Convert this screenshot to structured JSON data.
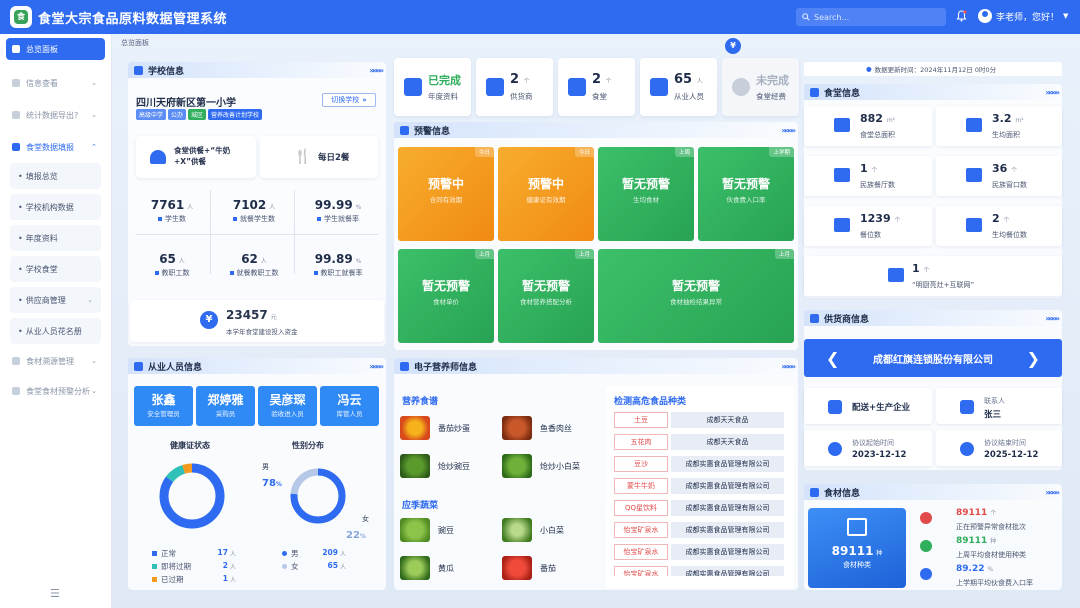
{
  "app": {
    "title": "食堂大宗食品原料数据管理系统",
    "logo_icon": "canteen-logo",
    "accent": "#2f6bf0"
  },
  "topbar": {
    "search_placeholder": "Search...",
    "user": "李老师，您好！"
  },
  "breadcrumb": "总览面板",
  "sidebar": {
    "items": [
      {
        "label": "总览面板",
        "active": true
      },
      {
        "label": "信息查看"
      },
      {
        "label": "统计数据导出?"
      },
      {
        "label": "食堂数据填报"
      }
    ],
    "subitems": [
      "填报总览",
      "学校机构数据",
      "年度资料",
      "学校食堂",
      "供应商管理",
      "从业人员花名册"
    ],
    "items_after": [
      "食材溯源管理",
      "食堂食材预警分析"
    ]
  },
  "school": {
    "header": "学校信息",
    "name": "四川天府新区第一小学",
    "switch_label": "切换学校",
    "tags": [
      "高级中学",
      "公办",
      "城区",
      "营养改善计划学校"
    ],
    "meal_supply": "食堂供餐+“牛奶+X”供餐",
    "meals_per_day": "每日2餐",
    "stats": [
      {
        "num": "7761",
        "unit": "人",
        "label": "学生数"
      },
      {
        "num": "7102",
        "unit": "人",
        "label": "就餐学生数"
      },
      {
        "num": "99.99",
        "unit": "%",
        "label": "学生就餐率"
      },
      {
        "num": "65",
        "unit": "人",
        "label": "教职工数"
      },
      {
        "num": "62",
        "unit": "人",
        "label": "就餐教职工数"
      },
      {
        "num": "99.89",
        "unit": "%",
        "label": "教职工就餐率"
      }
    ],
    "investment": {
      "num": "23457",
      "unit": "元",
      "label": "本学年食堂建设投入资金"
    }
  },
  "update_time": "数据更新时间：2024年11月12日 0时0分",
  "kpis": [
    {
      "num": "已完成",
      "unit": "",
      "label": "年度资料"
    },
    {
      "num": "2",
      "unit": "个",
      "label": "供货商"
    },
    {
      "num": "2",
      "unit": "个",
      "label": "食堂"
    },
    {
      "num": "65",
      "unit": "人",
      "label": "从业人员"
    },
    {
      "num": "未完成",
      "unit": "",
      "label": "食堂经费"
    }
  ],
  "warning": {
    "header": "预警信息",
    "cards": [
      {
        "title": "预警中",
        "sub": "合同有效期",
        "badge": "今日",
        "color": "#f39a1f"
      },
      {
        "title": "预警中",
        "sub": "健康证有效期",
        "badge": "今日",
        "color": "#f39a1f"
      },
      {
        "title": "暂无预警",
        "sub": "生均食材",
        "badge": "上周",
        "color": "#2fae5c"
      },
      {
        "title": "暂无预警",
        "sub": "伙食费入口率",
        "badge": "上学期",
        "color": "#2fae5c"
      },
      {
        "title": "暂无预警",
        "sub": "食材单价",
        "badge": "上月",
        "color": "#2fae5c"
      },
      {
        "title": "暂无预警",
        "sub": "食材营养搭配分析",
        "badge": "上月",
        "color": "#2fae5c"
      },
      {
        "title": "暂无预警",
        "sub": "食材抽检结果异常",
        "badge": "上月",
        "color": "#2fae5c"
      }
    ]
  },
  "canteen": {
    "header": "食堂信息",
    "cards": [
      {
        "num": "882",
        "unit": "m²",
        "label": "食堂总面积"
      },
      {
        "num": "3.2",
        "unit": "m²",
        "label": "生均面积"
      },
      {
        "num": "1",
        "unit": "个",
        "label": "民族餐厅数"
      },
      {
        "num": "36",
        "unit": "个",
        "label": "民族窗口数"
      },
      {
        "num": "1239",
        "unit": "个",
        "label": "餐位数"
      },
      {
        "num": "2",
        "unit": "个",
        "label": "生均餐位数"
      },
      {
        "num": "1",
        "unit": "个",
        "label": "“明厨亮灶+互联网”"
      }
    ]
  },
  "supplier": {
    "header": "供货商信息",
    "name": "成都红旗连锁股份有限公司",
    "type": "配送+生产企业",
    "contact_label": "联系人",
    "contact": "张三",
    "start_label": "协议起始时间",
    "start": "2023-12-12",
    "end_label": "协议结束时间",
    "end": "2025-12-12"
  },
  "staff": {
    "header": "从业人员信息",
    "people": [
      {
        "name": "张鑫",
        "role": "安全管理员"
      },
      {
        "name": "郑婷雅",
        "role": "采购员"
      },
      {
        "name": "吴彦琛",
        "role": "验收进入员"
      },
      {
        "name": "冯云",
        "role": "库管人员"
      }
    ],
    "health_title": "健康证状态",
    "health": [
      {
        "label": "正常",
        "value": 17,
        "unit": "人",
        "color": "#2f6bf0"
      },
      {
        "label": "即将过期",
        "value": 2,
        "unit": "人",
        "color": "#2fc0b8"
      },
      {
        "label": "已过期",
        "value": 1,
        "unit": "人",
        "color": "#f39a1f"
      }
    ],
    "gender_title": "性别分布",
    "gender": [
      {
        "label": "男",
        "pct": "78",
        "value": 209,
        "unit": "人",
        "color": "#2f6bf0"
      },
      {
        "label": "女",
        "pct": "22",
        "value": 65,
        "unit": "人",
        "color": "#b6c8e8"
      }
    ],
    "pct_unit": "%"
  },
  "nutrition": {
    "header": "电子营养师信息",
    "recipe_title": "营养食谱",
    "recipes": [
      "番茄炒蛋",
      "鱼香肉丝",
      "炝炒豌豆",
      "炝炒小白菜"
    ],
    "veg_title": "应季蔬菜",
    "vegetables": [
      "豌豆",
      "小白菜",
      "黄瓜",
      "番茄"
    ],
    "hot_title": "检测高危食品种类",
    "hot_rows": [
      {
        "food": "土豆",
        "org": "成都天天食品"
      },
      {
        "food": "五花肉",
        "org": "成都天天食品"
      },
      {
        "food": "豆沙",
        "org": "成都实惠食品管理有限公司"
      },
      {
        "food": "蒙牛牛奶",
        "org": "成都实惠食品管理有限公司"
      },
      {
        "food": "QQ星饮料",
        "org": "成都实惠食品管理有限公司"
      },
      {
        "food": "怡宝矿泉水",
        "org": "成都实惠食品管理有限公司"
      },
      {
        "food": "怡宝矿泉水",
        "org": "成都实惠食品管理有限公司"
      },
      {
        "food": "怡宝矿泉水",
        "org": "成都实惠食品管理有限公司"
      }
    ]
  },
  "ingredients": {
    "header": "食材信息",
    "big_num": "89111",
    "big_unit": "种",
    "big_label": "食材种类",
    "items": [
      {
        "num": "89111",
        "unit": "个",
        "label": "正在预警异常食材批次",
        "color": "#e24a4a"
      },
      {
        "num": "89111",
        "unit": "种",
        "label": "上周平均食材使用种类",
        "color": "#2fae5c"
      },
      {
        "num": "89.22",
        "unit": "%",
        "label": "上学期平均伙食费入口率",
        "color": "#2f6bf0"
      }
    ]
  }
}
